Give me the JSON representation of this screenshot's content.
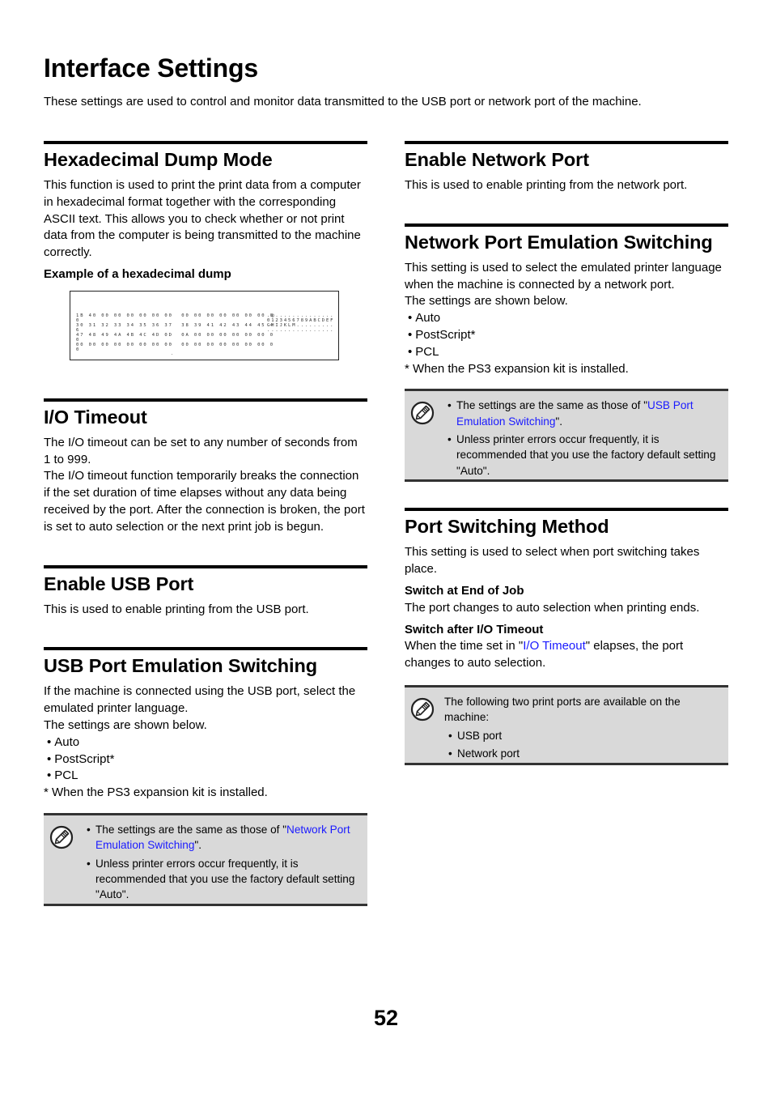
{
  "page": {
    "title": "Interface Settings",
    "intro": "These settings are used to control and monitor data transmitted to the USB port or network port of the machine.",
    "page_number": "52"
  },
  "hex_dump": {
    "sections_title": "Hexadecimal Dump Mode",
    "paragraph": "This function is used to print the print data from a computer in hexadecimal format together with the corresponding ASCII text. This allows you to check whether or not print data from the computer is being transmitted to the machine correctly.",
    "example_label": "Example of a hexadecimal dump",
    "hex_rows": [
      "1B 40 00 00 00 00 00 00  00 00 00 00 00 00 00 0",
      "0",
      "30 31 32 33 34 35 36 37  38 39 41 42 43 44 45 4",
      "6",
      "47 48 49 4A 4B 4C 4D 0D  0A 00 00 00 00 00 00 0",
      "0",
      "00 00 00 00 00 00 00 00  00 00 00 00 00 00 00 0",
      "0"
    ],
    "ascii_rows": [
      ".@..............",
      "0123456789ABCDEF",
      "GHIJKLM.........",
      "................"
    ],
    "trailing_mark": "."
  },
  "io_timeout": {
    "title": "I/O Timeout",
    "paragraphs": [
      "The I/O timeout can be set to any number of seconds from 1 to 999.",
      "The I/O timeout function temporarily breaks the connection if the set duration of time elapses without any data being received by the port. After the connection is broken, the port is set to auto selection or the next print job is begun."
    ]
  },
  "enable_usb": {
    "title": "Enable USB Port",
    "paragraph": "This is used to enable printing from the USB port."
  },
  "usb_emulation": {
    "title": "USB Port Emulation Switching",
    "paragraphs": [
      "If the machine is connected using the USB port, select the emulated printer language.",
      "The settings are shown below."
    ],
    "options": [
      "Auto",
      "PostScript*",
      "PCL"
    ],
    "footnote": "*  When the PS3 expansion kit is installed.",
    "note": {
      "icon": "pencil-note-icon",
      "item1_prefix": "The settings are the same as those of \"",
      "item1_link": "Network Port Emulation Switching",
      "item1_suffix": "\".",
      "item2": "Unless printer errors occur frequently, it is recommended that you use the factory default setting \"Auto\"."
    }
  },
  "enable_network": {
    "title": "Enable Network Port",
    "paragraph": "This is used to enable printing from the network port."
  },
  "network_emulation": {
    "title": "Network Port Emulation Switching",
    "paragraphs": [
      "This setting is used to select the emulated printer language when the machine is connected by a network port.",
      "The settings are shown below."
    ],
    "options": [
      "Auto",
      "PostScript*",
      "PCL"
    ],
    "footnote": "*  When the PS3 expansion kit is installed.",
    "note": {
      "icon": "pencil-note-icon",
      "item1_prefix": "The settings are the same as those of \"",
      "item1_link": "USB Port Emulation Switching",
      "item1_suffix": "\".",
      "item2": "Unless printer errors occur frequently, it is recommended that you use the factory default setting \"Auto\"."
    }
  },
  "port_switching": {
    "title": "Port Switching Method",
    "paragraph": "This setting is used to select when port switching takes place.",
    "option1_title": "Switch at End of Job",
    "option1_text": "The port changes to auto selection when printing ends.",
    "option2_title": "Switch after I/O Timeout",
    "option2_prefix": "When the time set in \"",
    "option2_link": "I/O Timeout",
    "option2_suffix": "\" elapses, the port changes to auto selection.",
    "note": {
      "icon": "pencil-note-icon",
      "text": "The following two print ports are available on the machine:",
      "items": [
        "USB port",
        "Network port"
      ]
    }
  },
  "colors": {
    "link": "#1a1aff",
    "note_background": "#d9d9d9",
    "rule": "#000000"
  }
}
